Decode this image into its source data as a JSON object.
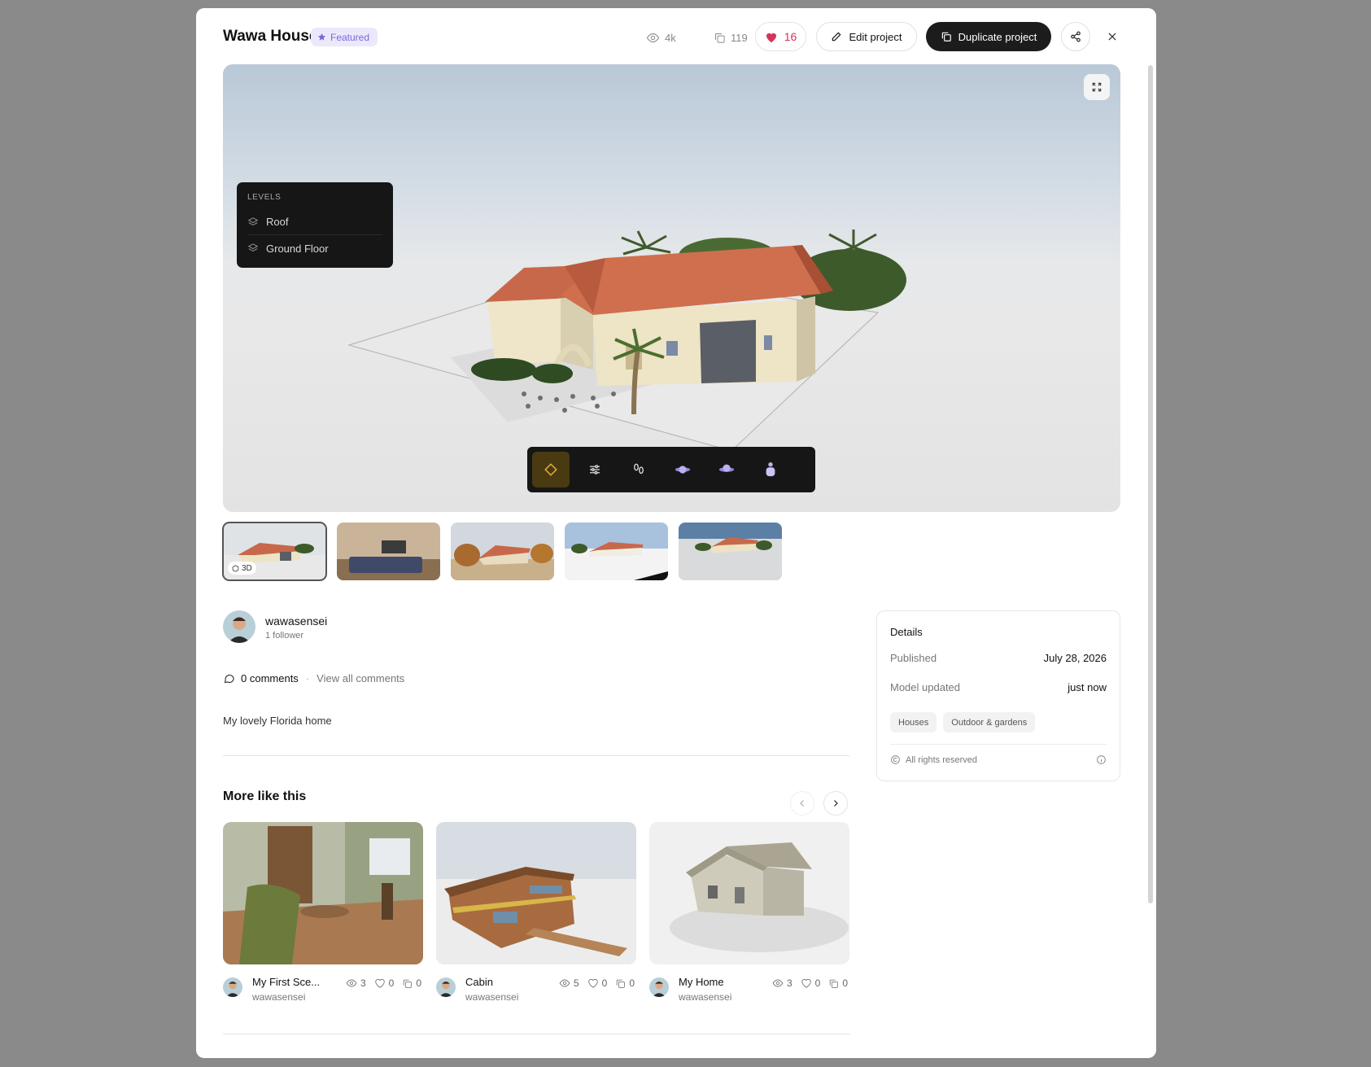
{
  "project": {
    "title": "Wawa House",
    "featured_label": "Featured",
    "views": "4k",
    "duplicates": "119",
    "likes": "16",
    "edit_label": "Edit project",
    "duplicate_label": "Duplicate project"
  },
  "viewer": {
    "levels_heading": "LEVELS",
    "levels": [
      "Roof",
      "Ground Floor"
    ],
    "toolbar_icons": [
      "select-icon",
      "settings-sliders-icon",
      "footsteps-icon",
      "orbit-low-icon",
      "orbit-high-icon",
      "person-view-icon"
    ]
  },
  "thumbnails": {
    "badge_label": "3D",
    "items": [
      "3d-model-thumbnail",
      "living-room-render-thumbnail",
      "autumn-exterior-render-thumbnail",
      "white-exterior-render-thumbnail",
      "aerial-exterior-render-thumbnail"
    ]
  },
  "author": {
    "name": "wawasensei",
    "followers": "1 follower"
  },
  "comments": {
    "count_label": "0 comments",
    "view_all": "View all comments"
  },
  "description": "My lovely Florida home",
  "details": {
    "title": "Details",
    "published_label": "Published",
    "published_value": "July 28, 2026",
    "updated_label": "Model updated",
    "updated_value": "just now",
    "tags": [
      "Houses",
      "Outdoor & gardens"
    ],
    "license": "All rights reserved"
  },
  "more": {
    "title": "More like this",
    "cards": [
      {
        "name": "My First Sce...",
        "user": "wawasensei",
        "views": "3",
        "likes": "0",
        "copies": "0"
      },
      {
        "name": "Cabin",
        "user": "wawasensei",
        "views": "5",
        "likes": "0",
        "copies": "0"
      },
      {
        "name": "My Home",
        "user": "wawasensei",
        "views": "3",
        "likes": "0",
        "copies": "0"
      }
    ]
  },
  "colors": {
    "accent_like": "#d6335a",
    "featured": "#7b68d8",
    "primary_button": "#1c1c1c"
  }
}
